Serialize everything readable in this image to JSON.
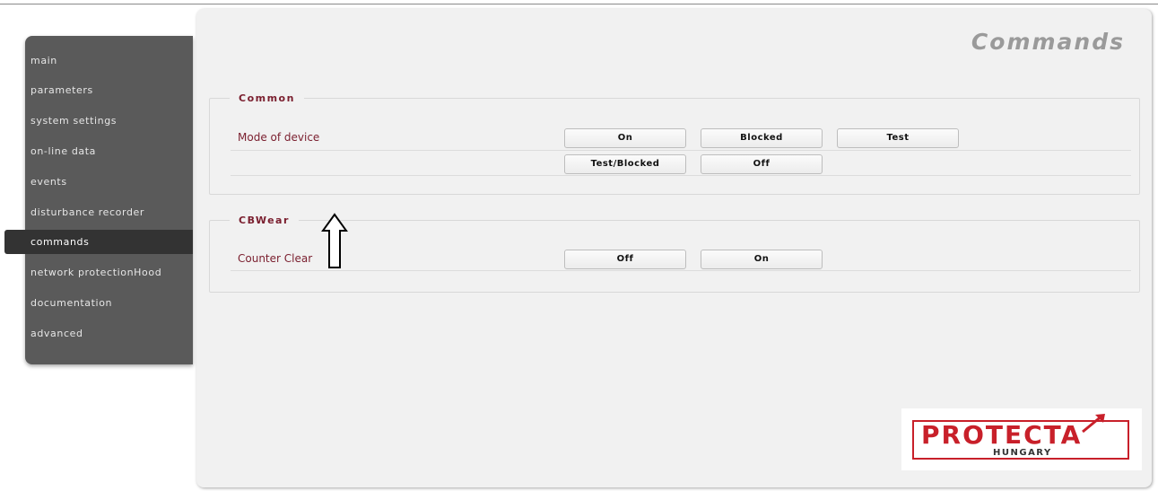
{
  "sidebar": {
    "items": [
      {
        "label": "main"
      },
      {
        "label": "parameters"
      },
      {
        "label": "system settings"
      },
      {
        "label": "on-line data"
      },
      {
        "label": "events"
      },
      {
        "label": "disturbance recorder"
      },
      {
        "label": "commands"
      },
      {
        "label": "network protectionHood"
      },
      {
        "label": "documentation"
      },
      {
        "label": "advanced"
      }
    ],
    "active": "commands"
  },
  "page": {
    "title": "Commands"
  },
  "sections": {
    "common": {
      "legend": "Common",
      "row_label": "Mode of device",
      "buttons": [
        "On",
        "Blocked",
        "Test",
        "Test/Blocked",
        "Off"
      ]
    },
    "cbwear": {
      "legend": "CBWear",
      "row_label": "Counter Clear",
      "buttons": [
        "Off",
        "On"
      ]
    }
  },
  "logo": {
    "text": "PROTECTA",
    "subtext": "HUNGARY"
  },
  "colors": {
    "accent": "#7a1e2e",
    "sidebar_bg": "#5a5a5a",
    "sidebar_active": "#333333",
    "logo_red": "#c8202a"
  }
}
